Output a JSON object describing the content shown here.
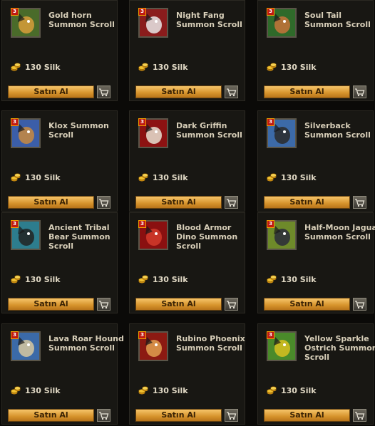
{
  "items": [
    {
      "name": "Gold horn Summon Scroll",
      "price": "130 Silk",
      "buy_label": "Satın Al",
      "badge": "3",
      "icon": "gold-horn-icon",
      "color": "#4a6b2a",
      "accent": "#d89e3a"
    },
    {
      "name": "Night Fang Summon Scroll",
      "price": "130 Silk",
      "buy_label": "Satın Al",
      "badge": "3",
      "icon": "night-fang-icon",
      "color": "#8a1c1c",
      "accent": "#e8e8e8"
    },
    {
      "name": "Soul Tail Summon Scroll",
      "price": "130 Silk",
      "buy_label": "Satın Al",
      "badge": "3",
      "icon": "soul-tail-icon",
      "color": "#2f6a2a",
      "accent": "#c7733a"
    },
    {
      "name": "Klox Summon Scroll",
      "price": "130 Silk",
      "buy_label": "Satın Al",
      "badge": "3",
      "icon": "klox-icon",
      "color": "#3b5ea8",
      "accent": "#c98a40"
    },
    {
      "name": "Dark Griffin Summon Scroll",
      "price": "130 Silk",
      "buy_label": "Satın Al",
      "badge": "3",
      "icon": "dark-griffin-icon",
      "color": "#8c1212",
      "accent": "#e8e2d2"
    },
    {
      "name": "Silverback Summon Scroll",
      "price": "130 Silk",
      "buy_label": "Satın Al",
      "badge": "3",
      "icon": "silverback-icon",
      "color": "#3c6aa8",
      "accent": "#2a2a2a"
    },
    {
      "name": "Ancient Tribal Bear Summon Scroll",
      "price": "130 Silk",
      "buy_label": "Satın Al",
      "badge": "3",
      "icon": "tribal-bear-icon",
      "color": "#2d7d8e",
      "accent": "#222"
    },
    {
      "name": "Blood Armor Dino Summon Scroll",
      "price": "130 Silk",
      "buy_label": "Satın Al",
      "badge": "3",
      "icon": "blood-dino-icon",
      "color": "#8a1010",
      "accent": "#d23b2b"
    },
    {
      "name": "Half-Moon Jaguar Summon Scroll",
      "price": "130 Silk",
      "buy_label": "Satın Al",
      "badge": "3",
      "icon": "jaguar-icon",
      "color": "#6e8a2a",
      "accent": "#2a2a3a"
    },
    {
      "name": "Lava Roar Hound Summon Scroll",
      "price": "130 Silk",
      "buy_label": "Satın Al",
      "badge": "3",
      "icon": "hound-icon",
      "color": "#3b6aa8",
      "accent": "#d8c8a0"
    },
    {
      "name": "Rubino Phoenix Summon Scroll",
      "price": "130 Silk",
      "buy_label": "Satın Al",
      "badge": "3",
      "icon": "phoenix-icon",
      "color": "#8c1a12",
      "accent": "#e0a050"
    },
    {
      "name": "Yellow Sparkle Ostrich Summon Scroll",
      "price": "130 Silk",
      "buy_label": "Satın Al",
      "badge": "3",
      "icon": "ostrich-icon",
      "color": "#4a8a2a",
      "accent": "#d8c020"
    }
  ],
  "colors": {
    "button": "#e3a845",
    "coin": "#f0c030"
  }
}
